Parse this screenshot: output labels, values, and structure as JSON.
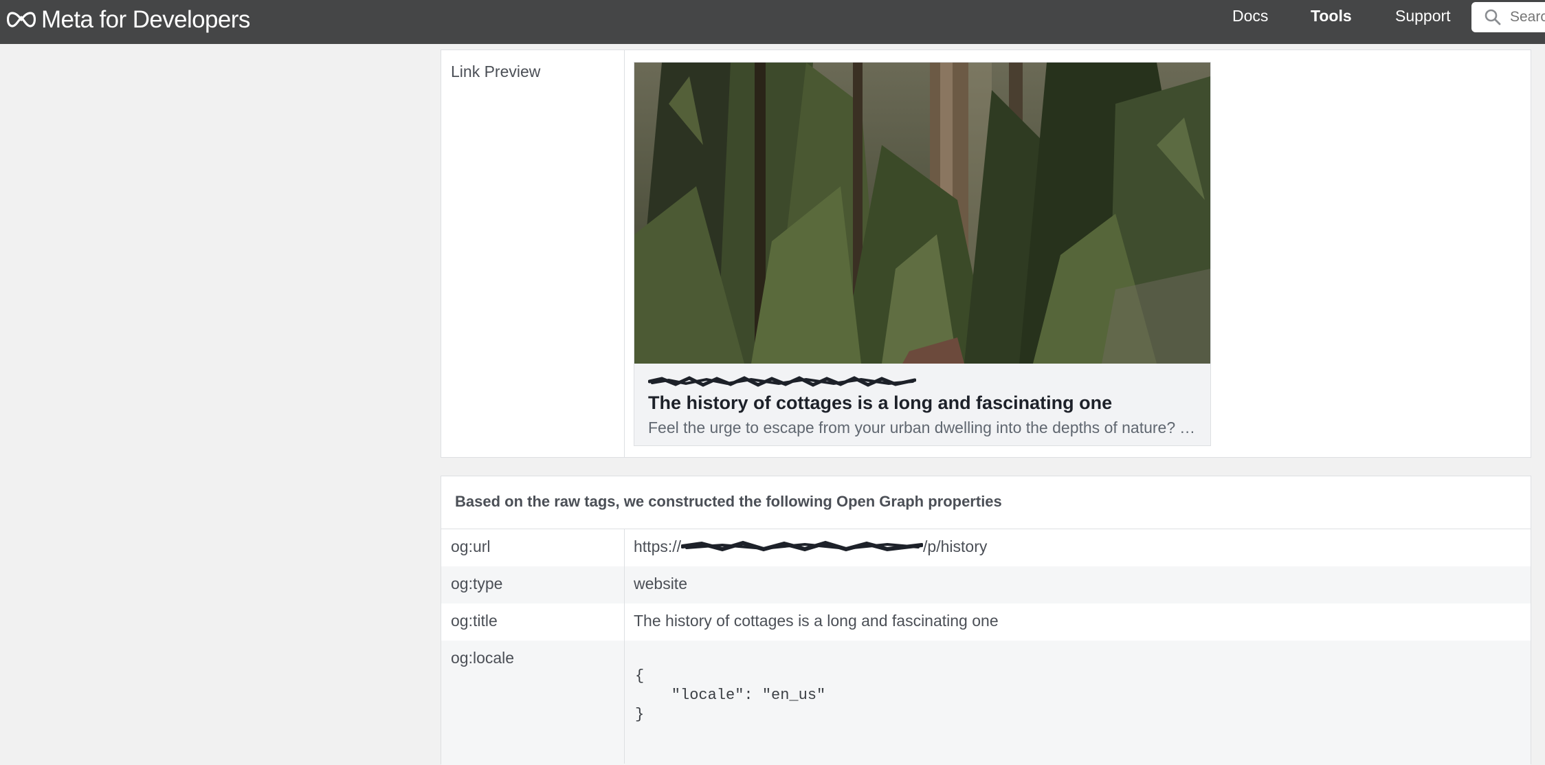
{
  "header": {
    "logo_text": "Meta for Developers",
    "nav": [
      "Docs",
      "Tools",
      "Support"
    ],
    "search_placeholder": "Search"
  },
  "link_preview": {
    "label": "Link Preview",
    "title": "The history of cottages is a long and fascinating one",
    "description": "Feel the urge to escape from your urban dwelling into the depths of nature? Your dream cottage awaits"
  },
  "og_properties": {
    "heading": "Based on the raw tags, we constructed the following Open Graph properties",
    "rows": [
      {
        "key": "og:url",
        "value_prefix": "https://",
        "value_suffix": "/p/history"
      },
      {
        "key": "og:type",
        "value": "website"
      },
      {
        "key": "og:title",
        "value": "The history of cottages is a long and fascinating one"
      },
      {
        "key": "og:locale",
        "value": "{\n    \"locale\": \"en_us\"\n}"
      }
    ]
  },
  "colors": {
    "topbar": "#454647",
    "page_background": "#f1f1f1",
    "alt_row": "#f5f6f7"
  }
}
